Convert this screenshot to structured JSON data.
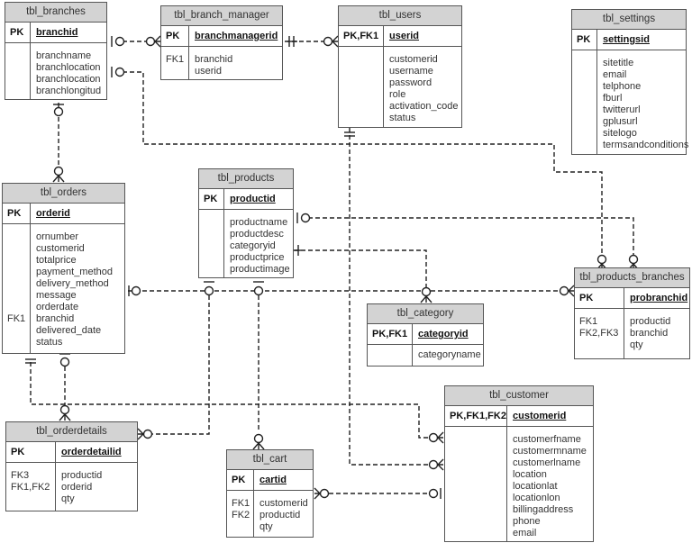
{
  "diagram_title": "",
  "tables": {
    "branches": {
      "name": "tbl_branches",
      "pk_label": "PK",
      "pk_field": "branchid",
      "fk_labels": [],
      "fields": [
        "branchname",
        "branchlocation",
        "branchlocation",
        "branchlongitud"
      ]
    },
    "branch_manager": {
      "name": "tbl_branch_manager",
      "pk_label": "PK",
      "pk_field": "branchmanagerid",
      "fk_labels": [
        "FK1",
        ""
      ],
      "fields": [
        "branchid",
        "userid"
      ]
    },
    "users": {
      "name": "tbl_users",
      "pk_label": "PK,FK1",
      "pk_field": "userid",
      "fk_labels": [],
      "fields": [
        "customerid",
        "username",
        "password",
        "role",
        "activation_code",
        "status"
      ]
    },
    "settings": {
      "name": "tbl_settings",
      "pk_label": "PK",
      "pk_field": "settingsid",
      "fk_labels": [],
      "fields": [
        "sitetitle",
        "email",
        "telphone",
        "fburl",
        "twitterurl",
        "gplusurl",
        "sitelogo",
        "termsandconditions"
      ]
    },
    "orders": {
      "name": "tbl_orders",
      "pk_label": "PK",
      "pk_field": "orderid",
      "fk_labels": [
        "",
        "",
        "",
        "",
        "",
        "",
        "",
        "FK1",
        "",
        ""
      ],
      "fields": [
        "ornumber",
        "customerid",
        "totalprice",
        "payment_method",
        "delivery_method",
        "message",
        "orderdate",
        "branchid",
        "delivered_date",
        "status"
      ]
    },
    "products": {
      "name": "tbl_products",
      "pk_label": "PK",
      "pk_field": "productid",
      "fk_labels": [],
      "fields": [
        "productname",
        "productdesc",
        "categoryid",
        "productprice",
        "productimage"
      ]
    },
    "category": {
      "name": "tbl_category",
      "pk_label": "PK,FK1",
      "pk_field": "categoryid",
      "fk_labels": [],
      "fields": [
        "categoryname"
      ]
    },
    "products_branches": {
      "name": "tbl_products_branches",
      "pk_label": "PK",
      "pk_field": "probranchid",
      "fk_labels": [
        "FK1",
        "FK2,FK3",
        ""
      ],
      "fields": [
        "productid",
        "branchid",
        "qty"
      ]
    },
    "orderdetails": {
      "name": "tbl_orderdetails",
      "pk_label": "PK",
      "pk_field": "orderdetailid",
      "fk_labels": [
        "FK3",
        "FK1,FK2",
        ""
      ],
      "fields": [
        "productid",
        "orderid",
        "qty"
      ]
    },
    "cart": {
      "name": "tbl_cart",
      "pk_label": "PK",
      "pk_field": "cartid",
      "fk_labels": [
        "FK1",
        "FK2",
        ""
      ],
      "fields": [
        "customerid",
        "productid",
        "qty"
      ]
    },
    "customer": {
      "name": "tbl_customer",
      "pk_label": "PK,FK1,FK2",
      "pk_field": "customerid",
      "fk_labels": [],
      "fields": [
        "customerfname",
        "customermname",
        "customerlname",
        "location",
        "locationlat",
        "locationlon",
        "billingaddress",
        "phone",
        "email"
      ]
    }
  },
  "relationships": [
    {
      "from": "tbl_branches",
      "to": "tbl_branch_manager",
      "from_end": "zero-or-one",
      "to_end": "zero-or-many"
    },
    {
      "from": "tbl_branch_manager",
      "to": "tbl_users",
      "from_end": "exactly-one",
      "to_end": "zero-or-many"
    },
    {
      "from": "tbl_branches",
      "to": "tbl_orders",
      "from_end": "zero-or-one",
      "to_end": "zero-or-many"
    },
    {
      "from": "tbl_branches",
      "to": "tbl_products_branches",
      "from_end": "zero-or-one",
      "to_end": "zero-or-many"
    },
    {
      "from": "tbl_products",
      "to": "tbl_products_branches",
      "from_end": "zero-or-one",
      "to_end": "zero-or-many"
    },
    {
      "from": "tbl_products",
      "to": "tbl_category",
      "from_end": "exactly-one",
      "to_end": "zero-or-many"
    },
    {
      "from": "tbl_orders",
      "to": "tbl_products_branches",
      "from_end": "zero-or-one",
      "to_end": "zero-or-many"
    },
    {
      "from": "tbl_orders",
      "to": "tbl_orderdetails",
      "from_end": "zero-or-one",
      "to_end": "zero-or-many"
    },
    {
      "from": "tbl_orders",
      "to": "tbl_customer",
      "from_end": "exactly-one",
      "to_end": "zero-or-many"
    },
    {
      "from": "tbl_products",
      "to": "tbl_orderdetails",
      "from_end": "zero-or-one",
      "to_end": "zero-or-many"
    },
    {
      "from": "tbl_products",
      "to": "tbl_cart",
      "from_end": "zero-or-one",
      "to_end": "zero-or-many"
    },
    {
      "from": "tbl_users",
      "to": "tbl_customer",
      "from_end": "exactly-one",
      "to_end": "zero-or-many"
    },
    {
      "from": "tbl_customer",
      "to": "tbl_cart",
      "from_end": "zero-or-one",
      "to_end": "zero-or-many"
    }
  ]
}
